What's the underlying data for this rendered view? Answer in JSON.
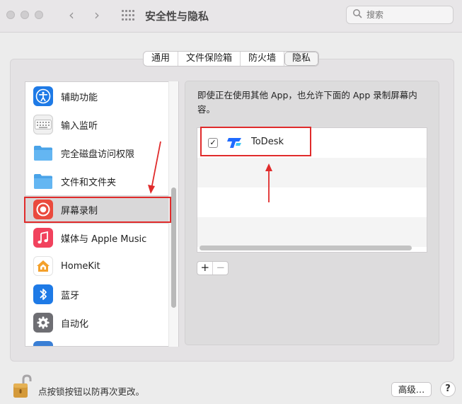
{
  "window": {
    "title": "安全性与隐私"
  },
  "search": {
    "placeholder": "搜索"
  },
  "tabs": [
    {
      "label": "通用",
      "selected": false
    },
    {
      "label": "文件保险箱",
      "selected": false
    },
    {
      "label": "防火墙",
      "selected": false
    },
    {
      "label": "隐私",
      "selected": true
    }
  ],
  "sidebar": {
    "items": [
      {
        "label": "辅助功能",
        "icon": "accessibility-icon",
        "color": "#1e7ae6"
      },
      {
        "label": "输入监听",
        "icon": "keyboard-icon",
        "color": "#e8e8e8"
      },
      {
        "label": "完全磁盘访问权限",
        "icon": "folder-icon",
        "color": "#4aa3e8"
      },
      {
        "label": "文件和文件夹",
        "icon": "folder-icon",
        "color": "#4aa3e8"
      },
      {
        "label": "屏幕录制",
        "icon": "screen-recording-icon",
        "color": "#ea4a3d",
        "selected": true
      },
      {
        "label": "媒体与 Apple Music",
        "icon": "music-icon",
        "color": "#f1425d"
      },
      {
        "label": "HomeKit",
        "icon": "home-icon",
        "color": "#f4a02a"
      },
      {
        "label": "蓝牙",
        "icon": "bluetooth-icon",
        "color": "#1e7ae6"
      },
      {
        "label": "自动化",
        "icon": "gear-icon",
        "color": "#6e6e73"
      }
    ]
  },
  "main": {
    "description": "即使正在使用其他 App，也允许下面的 App 录制屏幕内容。",
    "apps": [
      {
        "name": "ToDesk",
        "checked": true,
        "check_mark": "✓"
      }
    ],
    "add_label": "+",
    "remove_label": "−"
  },
  "footer": {
    "lock_text": "点按锁按钮以防再次更改。",
    "advanced_label": "高级…",
    "help_label": "?"
  },
  "colors": {
    "annotation_red": "#e02b2b",
    "todesk_blue": "#1f6bff"
  }
}
